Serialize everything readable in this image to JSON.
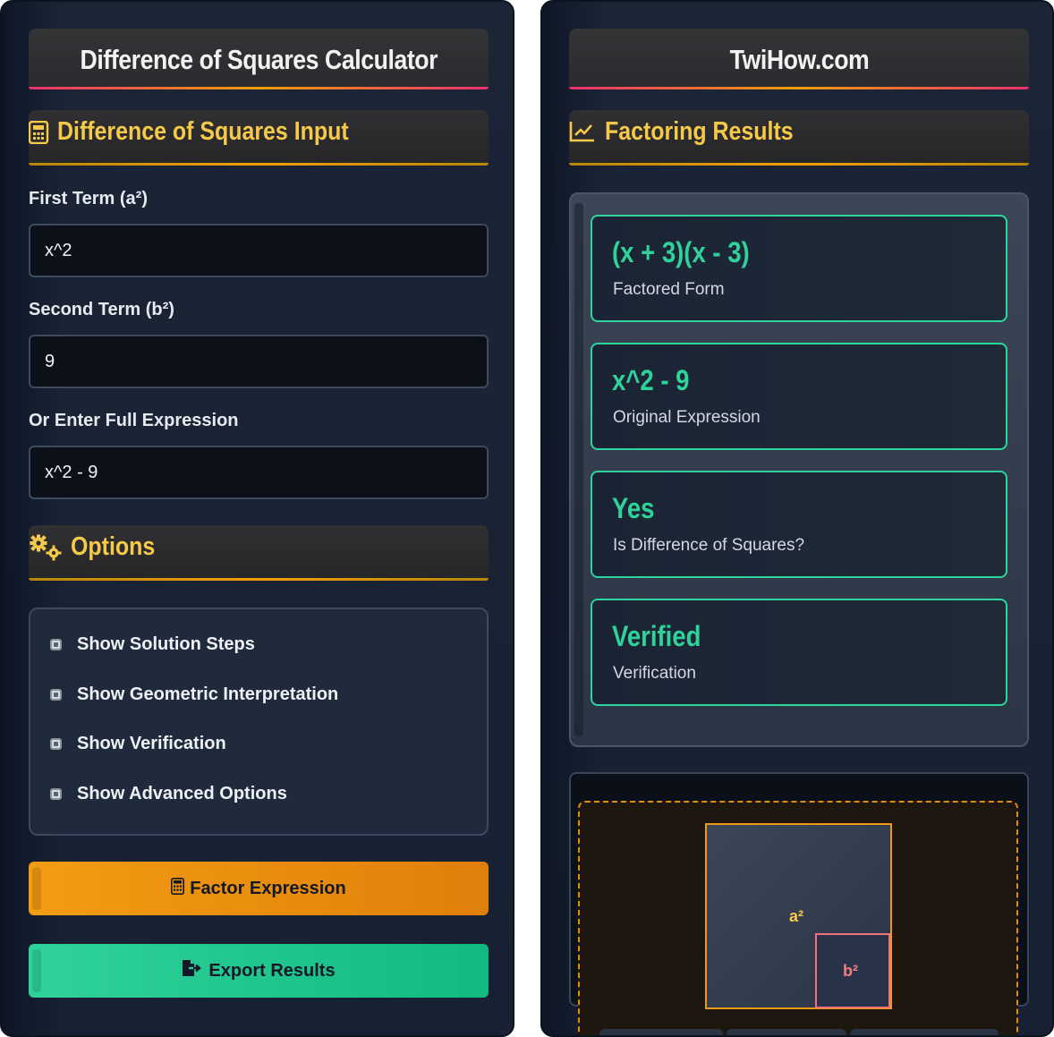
{
  "left": {
    "header_title": "Difference of Squares Calculator",
    "input_section_title": "Difference of Squares Input",
    "fields": [
      {
        "label": "First Term (a²)",
        "value": "x^2"
      },
      {
        "label": "Second Term (b²)",
        "value": "9"
      },
      {
        "label": "Or Enter Full Expression",
        "value": "x^2 - 9"
      }
    ],
    "options_section_title": "Options",
    "options": [
      {
        "label": "Show Solution Steps"
      },
      {
        "label": "Show Geometric Interpretation"
      },
      {
        "label": "Show Verification"
      },
      {
        "label": "Show Advanced Options"
      }
    ],
    "factor_button": "Factor Expression",
    "export_button": "Export Results"
  },
  "right": {
    "header_title": "TwiHow.com",
    "results_section_title": "Factoring Results",
    "results": [
      {
        "value": "(x + 3)(x - 3)",
        "label": "Factored Form"
      },
      {
        "value": "x^2 - 9",
        "label": "Original Expression"
      },
      {
        "value": "Yes",
        "label": "Is Difference of Squares?"
      },
      {
        "value": "Verified",
        "label": "Verification"
      }
    ],
    "geometric": {
      "square_a_label": "a²",
      "square_b_label": "b²"
    }
  },
  "colors": {
    "accent_yellow": "#f7c948",
    "accent_green": "#2fd39a",
    "accent_orange": "#f39c12",
    "accent_pink": "#e9316f"
  },
  "icons": {
    "input_section": "calculator-icon",
    "options_section": "gears-icon",
    "results_section": "chart-line-icon",
    "factor_button": "calculator-icon",
    "export_button": "file-export-icon"
  }
}
